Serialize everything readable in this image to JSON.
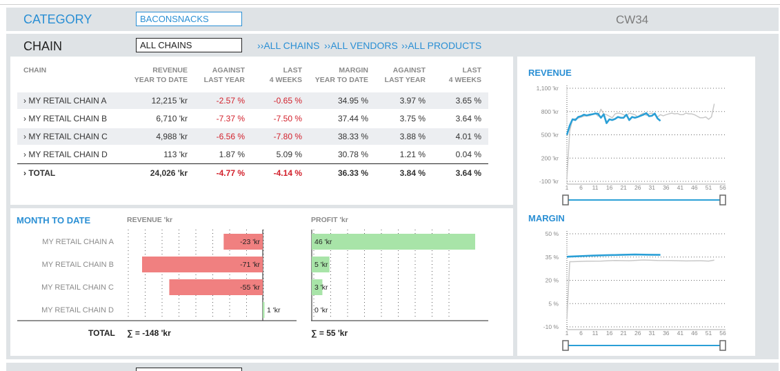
{
  "header": {
    "category_label": "CATEGORY",
    "category_value": "BACONSNACKS",
    "week": "CW34",
    "chain_label": "CHAIN",
    "chain_value": "ALL CHAINS",
    "links": [
      "››ALL CHAINS",
      "››ALL VENDORS",
      "››ALL PRODUCTS"
    ]
  },
  "table": {
    "columns": [
      {
        "l1": "CHAIN",
        "l2": ""
      },
      {
        "l1": "REVENUE",
        "l2": "YEAR TO DATE"
      },
      {
        "l1": "AGAINST",
        "l2": "LAST YEAR"
      },
      {
        "l1": "LAST",
        "l2": "4 WEEKS"
      },
      {
        "l1": "MARGIN",
        "l2": "YEAR TO DATE"
      },
      {
        "l1": "AGAINST",
        "l2": "LAST YEAR"
      },
      {
        "l1": "LAST",
        "l2": "4 WEEKS"
      }
    ],
    "rows": [
      {
        "name": "› MY RETAIL CHAIN A",
        "rev": "12,215 'kr",
        "ly": "-2.57 %",
        "l4": "-0.65 %",
        "mg": "34.95 %",
        "mly": "3.97 %",
        "m4": "3.65 %"
      },
      {
        "name": "› MY RETAIL CHAIN B",
        "rev": "6,710 'kr",
        "ly": "-7.37 %",
        "l4": "-7.50 %",
        "mg": "37.44 %",
        "mly": "3.75 %",
        "m4": "3.64 %"
      },
      {
        "name": "› MY RETAIL CHAIN C",
        "rev": "4,988 'kr",
        "ly": "-6.56 %",
        "l4": "-7.80 %",
        "mg": "38.33 %",
        "mly": "3.88 %",
        "m4": "4.01 %"
      },
      {
        "name": "› MY RETAIL CHAIN D",
        "rev": "113 'kr",
        "ly": "1.87 %",
        "l4": "5.09 %",
        "mg": "30.78 %",
        "mly": "1.21 %",
        "m4": "0.04 %"
      }
    ],
    "total": {
      "name": "› TOTAL",
      "rev": "24,026 'kr",
      "ly": "-4.77 %",
      "l4": "-4.14 %",
      "mg": "36.33 %",
      "mly": "3.84 %",
      "m4": "3.64 %"
    }
  },
  "mtd": {
    "title": "MONTH TO DATE",
    "revenue_header": "REVENUE 'kr",
    "profit_header": "PROFIT 'kr",
    "total_label": "TOTAL",
    "revenue_sum": "∑ = -148 'kr",
    "profit_sum": "∑ = 55 'kr",
    "chains": [
      "MY RETAIL CHAIN A",
      "MY RETAIL CHAIN B",
      "MY RETAIL CHAIN C",
      "MY RETAIL CHAIN D"
    ],
    "revenue_labels": [
      "-23 'kr",
      "-71 'kr",
      "-55 'kr",
      "1 'kr"
    ],
    "profit_labels": [
      "46 'kr",
      "5 'kr",
      "3 'kr",
      "0 'kr"
    ]
  },
  "chart_data": [
    {
      "type": "bar",
      "title": "REVENUE 'kr",
      "categories": [
        "MY RETAIL CHAIN A",
        "MY RETAIL CHAIN B",
        "MY RETAIL CHAIN C",
        "MY RETAIL CHAIN D"
      ],
      "values": [
        -23,
        -71,
        -55,
        1
      ],
      "colors": {
        "negative": "#f08080",
        "positive": "#a8e4a8"
      }
    },
    {
      "type": "bar",
      "title": "PROFIT 'kr",
      "categories": [
        "MY RETAIL CHAIN A",
        "MY RETAIL CHAIN B",
        "MY RETAIL CHAIN C",
        "MY RETAIL CHAIN D"
      ],
      "values": [
        46,
        5,
        3,
        0
      ],
      "colors": {
        "positive": "#a8e4a8"
      }
    },
    {
      "type": "line",
      "title": "REVENUE",
      "ytick_labels": [
        "1,100 'kr",
        "800 'kr",
        "500 'kr",
        "200 'kr",
        "-100 'kr"
      ],
      "yticks": [
        1100,
        800,
        500,
        200,
        -100
      ],
      "ylim": [
        -100,
        1100
      ],
      "xticks": [
        "1",
        "6",
        "11",
        "16",
        "21",
        "26",
        "31",
        "36",
        "41",
        "46",
        "51",
        "56"
      ],
      "xlim": [
        1,
        56
      ],
      "grid": true,
      "series": [
        {
          "color": "#c8c8c8",
          "x": [
            1,
            2,
            3,
            5,
            7,
            9,
            11,
            12,
            13,
            14,
            15,
            16,
            17,
            18,
            19,
            20,
            21,
            22,
            23,
            24,
            25,
            26,
            27,
            28,
            29,
            30,
            31,
            32,
            33,
            34,
            35,
            36,
            37,
            38,
            39,
            40,
            41,
            42,
            43,
            44,
            45,
            46,
            47,
            48,
            49,
            50,
            51,
            52,
            53
          ],
          "y": [
            -60,
            550,
            700,
            715,
            740,
            745,
            780,
            740,
            830,
            770,
            760,
            740,
            720,
            770,
            780,
            775,
            760,
            740,
            780,
            770,
            760,
            730,
            760,
            780,
            750,
            770,
            780,
            755,
            730,
            760,
            745,
            760,
            770,
            780,
            770,
            775,
            760,
            760,
            780,
            770,
            770,
            760,
            740,
            720,
            720,
            730,
            700,
            730,
            900
          ]
        },
        {
          "color": "#2a9fd6",
          "x": [
            1,
            2,
            3,
            4,
            5,
            6,
            7,
            8,
            9,
            10,
            11,
            12,
            13,
            14,
            15,
            16,
            17,
            18,
            19,
            20,
            21,
            22,
            23,
            24,
            25,
            26,
            27,
            28,
            29,
            30,
            31,
            32,
            33,
            34
          ],
          "y": [
            500,
            620,
            700,
            690,
            730,
            740,
            760,
            750,
            760,
            765,
            775,
            770,
            720,
            765,
            650,
            700,
            690,
            705,
            730,
            720,
            720,
            760,
            690,
            730,
            720,
            730,
            745,
            760,
            780,
            740,
            745,
            775,
            710,
            680
          ]
        }
      ]
    },
    {
      "type": "line",
      "title": "MARGIN",
      "ytick_labels": [
        "50 %",
        "35 %",
        "20 %",
        "5 %",
        "-10 %"
      ],
      "yticks": [
        50,
        35,
        20,
        5,
        -10
      ],
      "ylim": [
        -10,
        50
      ],
      "xticks": [
        "1",
        "6",
        "11",
        "16",
        "21",
        "26",
        "31",
        "36",
        "41",
        "46",
        "51",
        "56"
      ],
      "xlim": [
        1,
        56
      ],
      "grid": true,
      "series": [
        {
          "color": "#c8c8c8",
          "x": [
            1,
            2,
            3,
            8,
            13,
            18,
            23,
            28,
            33,
            38,
            43,
            48,
            51,
            53
          ],
          "y": [
            -5,
            32,
            32,
            32.3,
            32.4,
            32.8,
            32.6,
            33.1,
            32.8,
            32.7,
            32.5,
            32.6,
            32.4,
            33.0
          ]
        },
        {
          "color": "#2a9fd6",
          "x": [
            1,
            2,
            5,
            10,
            15,
            20,
            25,
            30,
            34
          ],
          "y": [
            35.2,
            35.3,
            35.5,
            35.9,
            36.2,
            36.4,
            36.6,
            36.5,
            36.4
          ]
        }
      ]
    }
  ]
}
